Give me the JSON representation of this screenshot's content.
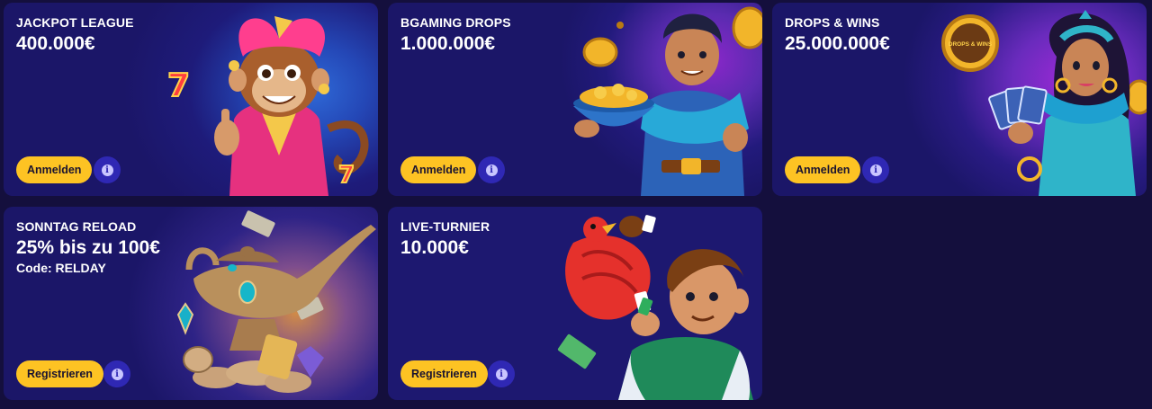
{
  "promos": [
    {
      "title": "JACKPOT LEAGUE",
      "amount": "400.000€",
      "button": "Anmelden",
      "info_icon": "info-icon",
      "art": "jester-monkey-illustration"
    },
    {
      "title": "BGAMING DROPS",
      "amount": "1.000.000€",
      "button": "Anmelden",
      "info_icon": "info-icon",
      "art": "genie-hero-with-gold-bowl-illustration"
    },
    {
      "title": "DROPS & WINS",
      "amount": "25.000.000€",
      "button": "Anmelden",
      "info_icon": "info-icon",
      "art": "princess-with-cards-illustration",
      "badge_text": "DROPS & WINS"
    },
    {
      "title": "SONNTAG RELOAD",
      "amount": "25% bis zu 100€",
      "code": "Code: RELDAY",
      "button": "Registrieren",
      "info_icon": "info-icon",
      "art": "magic-lamp-with-coins-illustration"
    },
    {
      "title": "LIVE-TURNIER",
      "amount": "10.000€",
      "button": "Registrieren",
      "info_icon": "info-icon",
      "art": "parrot-and-boy-illustration"
    }
  ],
  "colors": {
    "page_bg": "#140f3d",
    "card_bg": "#1c1670",
    "button_bg": "#fdc323",
    "info_bg": "#2f28b4",
    "text": "#ffffff"
  }
}
